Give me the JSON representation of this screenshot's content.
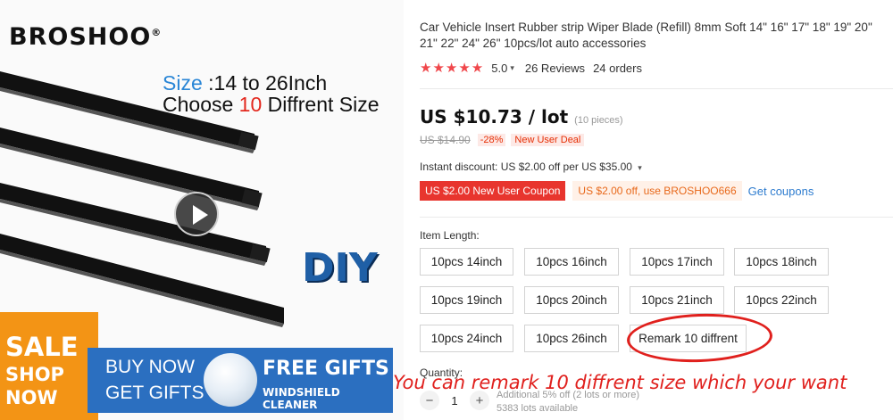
{
  "image": {
    "brand": "BROSHOO",
    "brand_mark": "®",
    "size_prefix": "Size",
    "size_text": " :14 to 26Inch",
    "choose_prefix": "Choose ",
    "choose_number": "10",
    "choose_suffix": " Diffrent Size",
    "diy": "DIY",
    "sale": "SALE",
    "shop": "SHOP",
    "now": "NOW",
    "buy_now": "BUY NOW",
    "get_gifts": "GET GIFTS",
    "free_gifts": "FREE GIFTS",
    "windshield_cleaner": "WINDSHIELD CLEANER"
  },
  "product": {
    "title": "Car Vehicle Insert Rubber strip Wiper Blade (Refill) 8mm Soft 14\" 16\" 17\" 18\" 19\" 20\" 21\" 22\" 24\" 26\" 10pcs/lot auto accessories",
    "rating_stars": "★★★★★",
    "rating_value": "5.0",
    "reviews": "26 Reviews",
    "orders": "24 orders"
  },
  "price": {
    "current": "US $10.73 / lot",
    "pieces": "(10 pieces)",
    "original": "US $14.90",
    "discount": "-28%",
    "new_user_deal": "New User Deal"
  },
  "coupons": {
    "instant_discount": "Instant discount: US $2.00 off per US $35.00",
    "new_user_coupon": "US $2.00 New User Coupon",
    "code_coupon": "US $2.00 off, use BROSHOO666",
    "get_coupons": "Get coupons"
  },
  "options": {
    "label": "Item Length:",
    "items": [
      "10pcs 14inch",
      "10pcs 16inch",
      "10pcs 17inch",
      "10pcs 18inch",
      "10pcs 19inch",
      "10pcs 20inch",
      "10pcs 21inch",
      "10pcs 22inch",
      "10pcs 24inch",
      "10pcs 26inch",
      "Remark 10 diffrent"
    ]
  },
  "annotation": "You can remark 10 diffrent size which your want",
  "quantity": {
    "label": "Quantity:",
    "value": "1",
    "minus": "−",
    "plus": "+",
    "note_discount": "Additional 5% off (2 lots or more)",
    "note_available": "5383 lots available"
  },
  "colors": {
    "accent_red": "#e8352e",
    "star": "#f0474b",
    "link_blue": "#2e7ccf",
    "banner_blue": "#2b6fc0",
    "sale_orange": "#f39415"
  }
}
